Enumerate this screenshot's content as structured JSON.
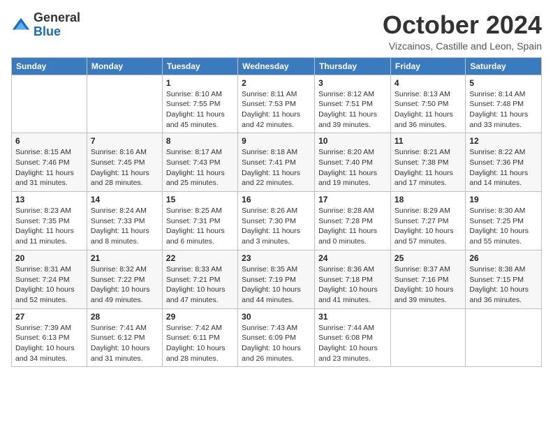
{
  "header": {
    "logo_line1": "General",
    "logo_line2": "Blue",
    "month_title": "October 2024",
    "location": "Vizcainos, Castille and Leon, Spain"
  },
  "days_of_week": [
    "Sunday",
    "Monday",
    "Tuesday",
    "Wednesday",
    "Thursday",
    "Friday",
    "Saturday"
  ],
  "weeks": [
    [
      {
        "day": "",
        "info": ""
      },
      {
        "day": "",
        "info": ""
      },
      {
        "day": "1",
        "info": "Sunrise: 8:10 AM\nSunset: 7:55 PM\nDaylight: 11 hours and 45 minutes."
      },
      {
        "day": "2",
        "info": "Sunrise: 8:11 AM\nSunset: 7:53 PM\nDaylight: 11 hours and 42 minutes."
      },
      {
        "day": "3",
        "info": "Sunrise: 8:12 AM\nSunset: 7:51 PM\nDaylight: 11 hours and 39 minutes."
      },
      {
        "day": "4",
        "info": "Sunrise: 8:13 AM\nSunset: 7:50 PM\nDaylight: 11 hours and 36 minutes."
      },
      {
        "day": "5",
        "info": "Sunrise: 8:14 AM\nSunset: 7:48 PM\nDaylight: 11 hours and 33 minutes."
      }
    ],
    [
      {
        "day": "6",
        "info": "Sunrise: 8:15 AM\nSunset: 7:46 PM\nDaylight: 11 hours and 31 minutes."
      },
      {
        "day": "7",
        "info": "Sunrise: 8:16 AM\nSunset: 7:45 PM\nDaylight: 11 hours and 28 minutes."
      },
      {
        "day": "8",
        "info": "Sunrise: 8:17 AM\nSunset: 7:43 PM\nDaylight: 11 hours and 25 minutes."
      },
      {
        "day": "9",
        "info": "Sunrise: 8:18 AM\nSunset: 7:41 PM\nDaylight: 11 hours and 22 minutes."
      },
      {
        "day": "10",
        "info": "Sunrise: 8:20 AM\nSunset: 7:40 PM\nDaylight: 11 hours and 19 minutes."
      },
      {
        "day": "11",
        "info": "Sunrise: 8:21 AM\nSunset: 7:38 PM\nDaylight: 11 hours and 17 minutes."
      },
      {
        "day": "12",
        "info": "Sunrise: 8:22 AM\nSunset: 7:36 PM\nDaylight: 11 hours and 14 minutes."
      }
    ],
    [
      {
        "day": "13",
        "info": "Sunrise: 8:23 AM\nSunset: 7:35 PM\nDaylight: 11 hours and 11 minutes."
      },
      {
        "day": "14",
        "info": "Sunrise: 8:24 AM\nSunset: 7:33 PM\nDaylight: 11 hours and 8 minutes."
      },
      {
        "day": "15",
        "info": "Sunrise: 8:25 AM\nSunset: 7:31 PM\nDaylight: 11 hours and 6 minutes."
      },
      {
        "day": "16",
        "info": "Sunrise: 8:26 AM\nSunset: 7:30 PM\nDaylight: 11 hours and 3 minutes."
      },
      {
        "day": "17",
        "info": "Sunrise: 8:28 AM\nSunset: 7:28 PM\nDaylight: 11 hours and 0 minutes."
      },
      {
        "day": "18",
        "info": "Sunrise: 8:29 AM\nSunset: 7:27 PM\nDaylight: 10 hours and 57 minutes."
      },
      {
        "day": "19",
        "info": "Sunrise: 8:30 AM\nSunset: 7:25 PM\nDaylight: 10 hours and 55 minutes."
      }
    ],
    [
      {
        "day": "20",
        "info": "Sunrise: 8:31 AM\nSunset: 7:24 PM\nDaylight: 10 hours and 52 minutes."
      },
      {
        "day": "21",
        "info": "Sunrise: 8:32 AM\nSunset: 7:22 PM\nDaylight: 10 hours and 49 minutes."
      },
      {
        "day": "22",
        "info": "Sunrise: 8:33 AM\nSunset: 7:21 PM\nDaylight: 10 hours and 47 minutes."
      },
      {
        "day": "23",
        "info": "Sunrise: 8:35 AM\nSunset: 7:19 PM\nDaylight: 10 hours and 44 minutes."
      },
      {
        "day": "24",
        "info": "Sunrise: 8:36 AM\nSunset: 7:18 PM\nDaylight: 10 hours and 41 minutes."
      },
      {
        "day": "25",
        "info": "Sunrise: 8:37 AM\nSunset: 7:16 PM\nDaylight: 10 hours and 39 minutes."
      },
      {
        "day": "26",
        "info": "Sunrise: 8:38 AM\nSunset: 7:15 PM\nDaylight: 10 hours and 36 minutes."
      }
    ],
    [
      {
        "day": "27",
        "info": "Sunrise: 7:39 AM\nSunset: 6:13 PM\nDaylight: 10 hours and 34 minutes."
      },
      {
        "day": "28",
        "info": "Sunrise: 7:41 AM\nSunset: 6:12 PM\nDaylight: 10 hours and 31 minutes."
      },
      {
        "day": "29",
        "info": "Sunrise: 7:42 AM\nSunset: 6:11 PM\nDaylight: 10 hours and 28 minutes."
      },
      {
        "day": "30",
        "info": "Sunrise: 7:43 AM\nSunset: 6:09 PM\nDaylight: 10 hours and 26 minutes."
      },
      {
        "day": "31",
        "info": "Sunrise: 7:44 AM\nSunset: 6:08 PM\nDaylight: 10 hours and 23 minutes."
      },
      {
        "day": "",
        "info": ""
      },
      {
        "day": "",
        "info": ""
      }
    ]
  ]
}
